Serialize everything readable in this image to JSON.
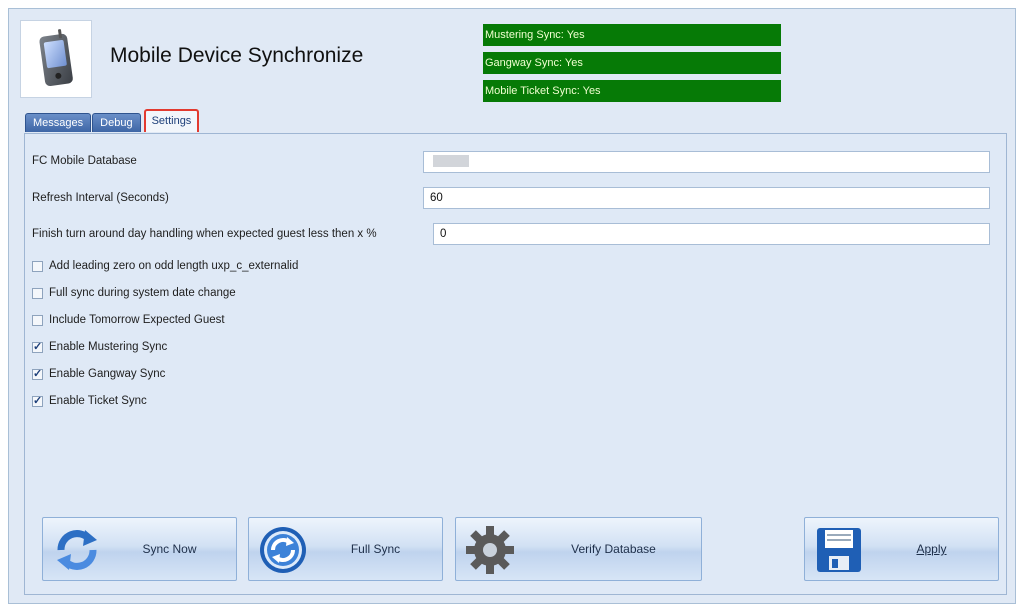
{
  "window": {
    "title": "Mobile Device Synchronize"
  },
  "status": [
    {
      "text": "Mustering Sync: Yes"
    },
    {
      "text": "Gangway Sync: Yes"
    },
    {
      "text": "Mobile Ticket Sync: Yes"
    }
  ],
  "colors": {
    "status_bg": "#067a06",
    "active_tab_border": "#e23a2f",
    "tab_bg": "#4a72b4"
  },
  "tabs": [
    {
      "label": "Messages",
      "active": false
    },
    {
      "label": "Debug",
      "active": false
    },
    {
      "label": "Settings",
      "active": true
    }
  ],
  "fields": {
    "database": {
      "label": "FC Mobile Database",
      "value": ""
    },
    "refresh": {
      "label": "Refresh Interval (Seconds)",
      "value": "60"
    },
    "turnaround": {
      "label": "Finish turn around day handling when expected guest less then x %",
      "value": "0"
    }
  },
  "options": [
    {
      "label": "Add leading zero on odd length uxp_c_externalid",
      "checked": false
    },
    {
      "label": "Full sync during system date change",
      "checked": false
    },
    {
      "label": "Include Tomorrow Expected Guest",
      "checked": false
    },
    {
      "label": "Enable Mustering Sync",
      "checked": true
    },
    {
      "label": "Enable Gangway Sync",
      "checked": true
    },
    {
      "label": "Enable Ticket Sync",
      "checked": true
    }
  ],
  "buttons": {
    "sync_now": {
      "label": "Sync Now",
      "icon": "sync-arrows-icon"
    },
    "full_sync": {
      "label": "Full Sync",
      "icon": "full-sync-icon"
    },
    "verify": {
      "label": "Verify Database",
      "icon": "gear-icon"
    },
    "apply": {
      "label": "Apply",
      "icon": "floppy-disk-icon"
    }
  }
}
